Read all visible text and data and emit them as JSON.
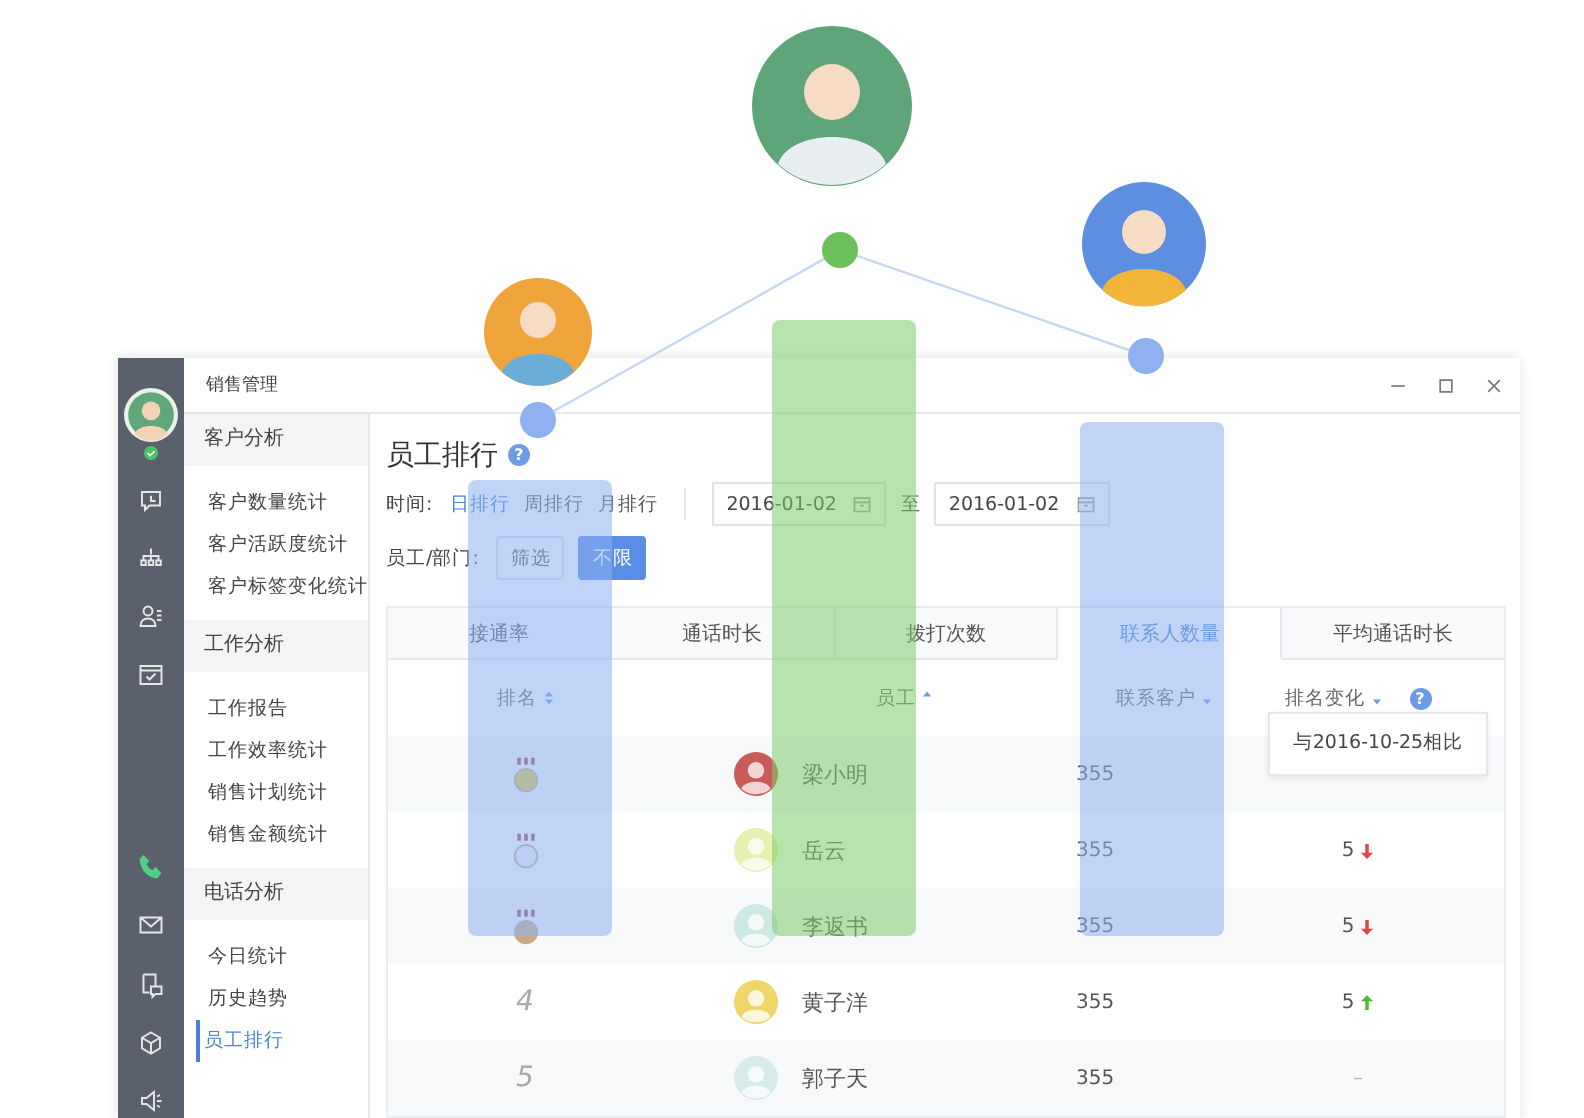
{
  "window": {
    "title": "销售管理"
  },
  "user": {
    "online": true
  },
  "rail_top": [
    {
      "selected": false
    },
    {
      "selected": false
    },
    {
      "selected": false
    },
    {
      "selected": false
    }
  ],
  "rail_bottom": [
    {
      "selected": true
    },
    {
      "selected": false
    },
    {
      "selected": false
    },
    {
      "selected": false
    },
    {
      "selected": false
    }
  ],
  "menu": [
    {
      "title": "客户分析",
      "items": [
        {
          "label": "客户数量统计",
          "selected": false
        },
        {
          "label": "客户活跃度统计",
          "selected": false
        },
        {
          "label": "客户标签变化统计",
          "selected": false
        }
      ]
    },
    {
      "title": "工作分析",
      "items": [
        {
          "label": "工作报告",
          "selected": false
        },
        {
          "label": "工作效率统计",
          "selected": false
        },
        {
          "label": "销售计划统计",
          "selected": false
        },
        {
          "label": "销售金额统计",
          "selected": false
        }
      ]
    },
    {
      "title": "电话分析",
      "items": [
        {
          "label": "今日统计",
          "selected": false
        },
        {
          "label": "历史趋势",
          "selected": false
        },
        {
          "label": "员工排行",
          "selected": true
        }
      ]
    }
  ],
  "heading": "员工排行",
  "heading_help": "?",
  "time_filter": {
    "label": "时间:",
    "options": [
      {
        "label": "日排行",
        "selected": true
      },
      {
        "label": "周排行",
        "selected": false
      },
      {
        "label": "月排行",
        "selected": false
      }
    ]
  },
  "date_range": {
    "start": "2016-01-02",
    "separator": "至",
    "end": "2016-01-02"
  },
  "staff_filter": {
    "label": "员工/部门:",
    "options": [
      {
        "label": "筛选",
        "selected": false
      },
      {
        "label": "不限",
        "selected": true
      }
    ]
  },
  "tabs": [
    {
      "label": "接通率",
      "selected": false
    },
    {
      "label": "通话时长",
      "selected": false
    },
    {
      "label": "拨打次数",
      "selected": false
    },
    {
      "label": "联系人数量",
      "selected": true
    },
    {
      "label": "平均通话时长",
      "selected": false
    }
  ],
  "columns": [
    {
      "label": "排名",
      "kind": "both"
    },
    {
      "label": "员工",
      "kind": "ascending"
    },
    {
      "label": "联系客户",
      "kind": "descending"
    },
    {
      "label": "排名变化",
      "kind": "descending"
    }
  ],
  "column_help": "?",
  "tooltip": "与2016-10-25相比",
  "rows": [
    {
      "rank": {
        "kind": "gold"
      },
      "name": "梁小明",
      "color": "#c95b5b",
      "count": "355"
    },
    {
      "rank": {
        "kind": "silver"
      },
      "name": "岳云",
      "color": "#e6f0b0",
      "count": "355",
      "change": {
        "value": "5",
        "kind": "down"
      }
    },
    {
      "rank": {
        "kind": "bronze"
      },
      "name": "李返书",
      "color": "#cde9e4",
      "count": "355",
      "change": {
        "value": "5",
        "kind": "down"
      }
    },
    {
      "rank": {
        "kind": "number",
        "text": "4"
      },
      "name": "黄子洋",
      "color": "#efd56a",
      "count": "355",
      "change": {
        "value": "5",
        "kind": "up"
      }
    },
    {
      "rank": {
        "kind": "number",
        "text": "5"
      },
      "name": "郭子天",
      "color": "#d6ebea",
      "count": "355",
      "change": {
        "value": "–",
        "kind": "none"
      }
    }
  ]
}
